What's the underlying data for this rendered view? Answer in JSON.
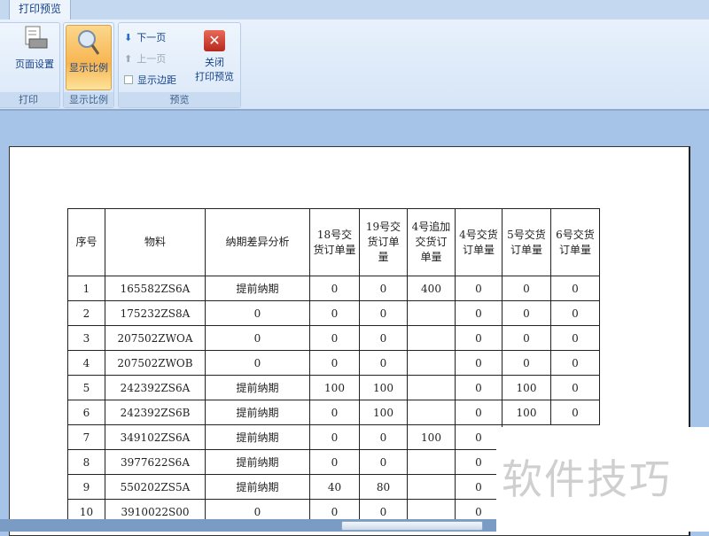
{
  "tab": "打印预览",
  "ribbon": {
    "print_group": {
      "label": "打印",
      "page_setup": "页面设置"
    },
    "zoom_group": {
      "label": "显示比例",
      "zoom": "显示比例"
    },
    "preview_group": {
      "label": "预览",
      "next": "下一页",
      "prev": "上一页",
      "margins": "显示边距",
      "close_line1": "关闭",
      "close_line2": "打印预览"
    }
  },
  "table": {
    "headers": [
      "序号",
      "物料",
      "纳期差异分析",
      "18号交货订单量",
      "19号交货订单量",
      "4号追加交货订单量",
      "4号交货订单量",
      "5号交货订单量",
      "6号交货订单量"
    ],
    "rows": [
      [
        "1",
        "165582ZS6A",
        "提前纳期",
        "0",
        "0",
        "400",
        "0",
        "0",
        "0"
      ],
      [
        "2",
        "175232ZS8A",
        "0",
        "0",
        "0",
        "",
        "0",
        "0",
        "0"
      ],
      [
        "3",
        "207502ZWOA",
        "0",
        "0",
        "0",
        "",
        "0",
        "0",
        "0"
      ],
      [
        "4",
        "207502ZWOB",
        "0",
        "0",
        "0",
        "",
        "0",
        "0",
        "0"
      ],
      [
        "5",
        "242392ZS6A",
        "提前纳期",
        "100",
        "100",
        "",
        "0",
        "100",
        "0"
      ],
      [
        "6",
        "242392ZS6B",
        "提前纳期",
        "0",
        "100",
        "",
        "0",
        "100",
        "0"
      ],
      [
        "7",
        "349102ZS6A",
        "提前纳期",
        "0",
        "0",
        "100",
        "0",
        "",
        ""
      ],
      [
        "8",
        "3977622S6A",
        "提前纳期",
        "0",
        "0",
        "",
        "0",
        "",
        ""
      ],
      [
        "9",
        "550202ZS5A",
        "提前纳期",
        "40",
        "80",
        "",
        "0",
        "",
        ""
      ],
      [
        "10",
        "3910022S00",
        "0",
        "0",
        "0",
        "",
        "0",
        "",
        ""
      ]
    ]
  },
  "watermark": "软件技巧"
}
